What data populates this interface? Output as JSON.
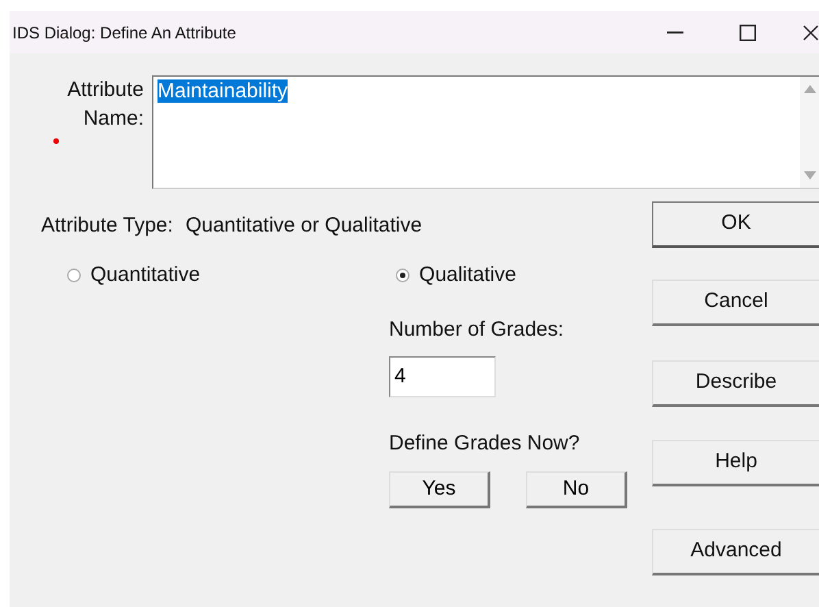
{
  "window": {
    "title": "IDS Dialog: Define An Attribute"
  },
  "name_field": {
    "label": "Attribute Name:",
    "value": "Maintainability",
    "text_selected": true,
    "required": true
  },
  "attribute_type": {
    "label": "Attribute Type:",
    "hint": "Quantitative or Qualitative"
  },
  "radios": [
    {
      "label": "Quantitative",
      "checked": false
    },
    {
      "label": "Qualitative",
      "checked": true
    }
  ],
  "grades": {
    "label": "Number of Grades:",
    "value": "4"
  },
  "define_now": {
    "label": "Define Grades Now?",
    "buttons": [
      "Yes",
      "No"
    ]
  },
  "buttons": [
    {
      "label": "OK",
      "default": true
    },
    {
      "label": "Cancel",
      "default": false
    },
    {
      "label": "Describe",
      "default": false
    },
    {
      "label": "Help",
      "default": false
    },
    {
      "label": "Advanced",
      "default": false
    }
  ]
}
